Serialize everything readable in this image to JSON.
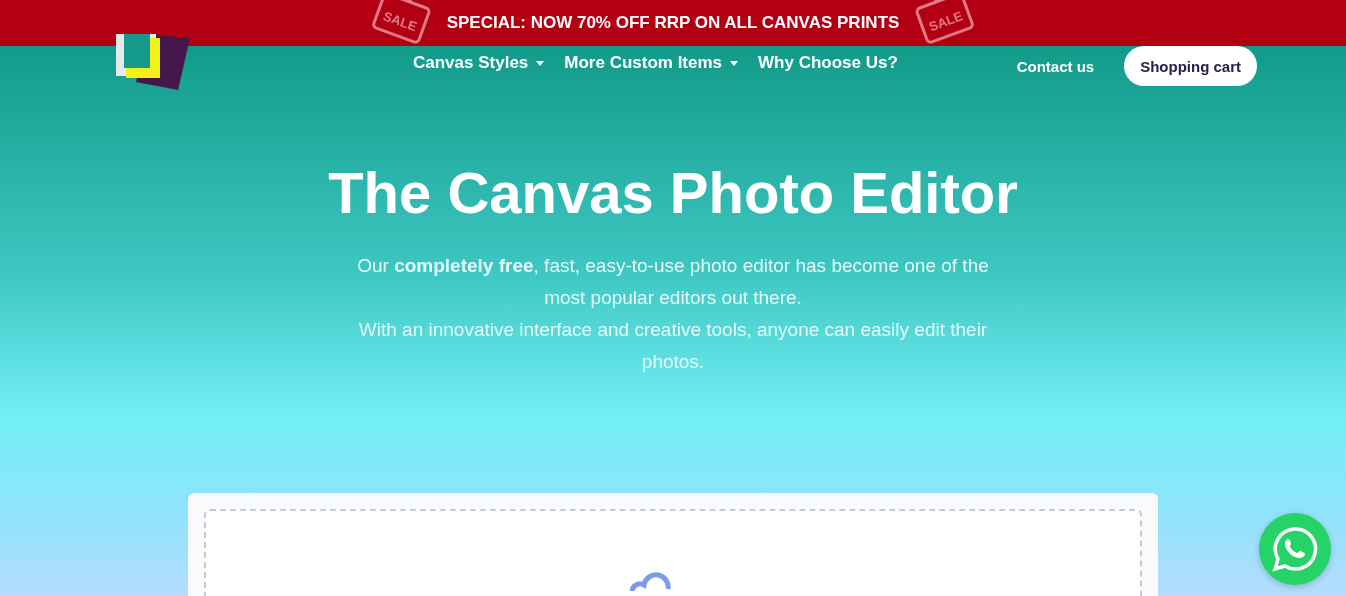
{
  "banner": {
    "text": "SPECIAL: NOW 70% OFF RRP ON ALL CANVAS PRINTS",
    "tags": [
      {
        "label": "SALE"
      },
      {
        "label": "SALE"
      }
    ]
  },
  "nav": {
    "items": [
      {
        "label": "Canvas Styles",
        "dropdown": true
      },
      {
        "label": "More Custom Items",
        "dropdown": true
      },
      {
        "label": "Why Choose Us?",
        "dropdown": false
      }
    ],
    "contact": "Contact us",
    "cart": "Shopping cart"
  },
  "hero": {
    "title": "The Canvas Photo Editor",
    "lines": [
      "Our **completely free**, fast, easy-to-use photo editor has become one of the most popular editors out there.",
      "With an innovative interface and creative tools, anyone can easily edit their photos."
    ]
  }
}
